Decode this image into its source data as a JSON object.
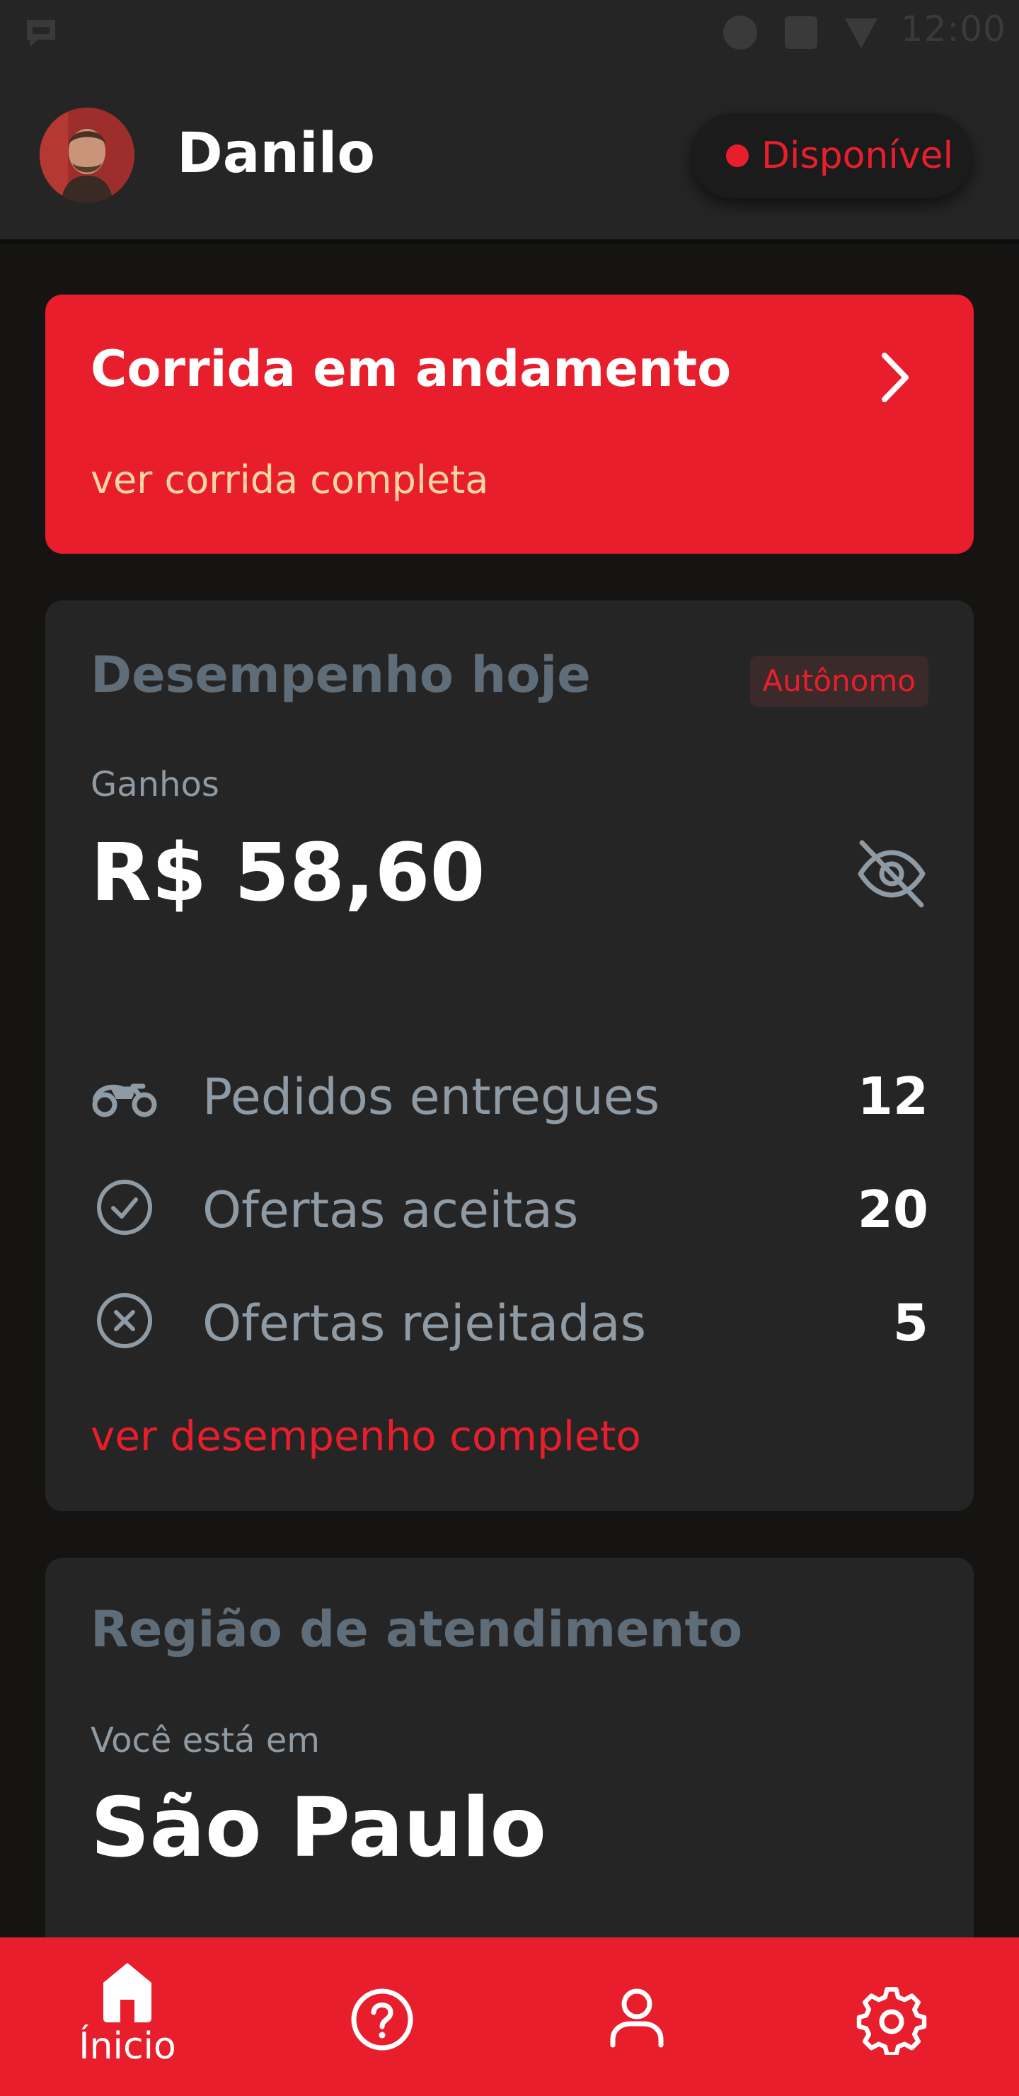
{
  "status_bar": {
    "time": "12:00"
  },
  "header": {
    "user_name": "Danilo",
    "status_label": "Disponível"
  },
  "ride_card": {
    "title": "Corrida em andamento",
    "link": "ver corrida completa"
  },
  "performance": {
    "title": "Desempenho hoje",
    "badge": "Autônomo",
    "earnings_label": "Ganhos",
    "earnings_value": "R$ 58,60",
    "stats": [
      {
        "icon": "motorcycle-icon",
        "label": "Pedidos entregues",
        "value": "12"
      },
      {
        "icon": "check-circle-icon",
        "label": "Ofertas aceitas",
        "value": "20"
      },
      {
        "icon": "x-circle-icon",
        "label": "Ofertas rejeitadas",
        "value": "5"
      }
    ],
    "link": "ver desempenho completo"
  },
  "region": {
    "title": "Região de atendimento",
    "label": "Você está em",
    "city": "São Paulo"
  },
  "bottom_nav": {
    "items": [
      {
        "icon": "home-icon",
        "label": "Ínicio",
        "active": true
      },
      {
        "icon": "help-icon",
        "label": ""
      },
      {
        "icon": "profile-icon",
        "label": ""
      },
      {
        "icon": "settings-icon",
        "label": ""
      }
    ]
  },
  "colors": {
    "accent": "#e91e2c",
    "background": "#151413",
    "card": "#252525",
    "muted_text": "#8e9aa4",
    "link_light": "#ffd6a2"
  }
}
